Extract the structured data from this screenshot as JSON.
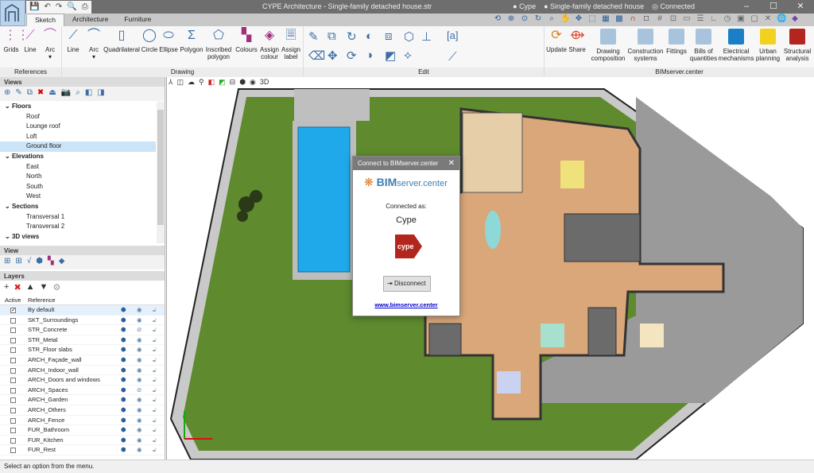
{
  "app": {
    "title": "CYPE Architecture - Single-family detached house.str",
    "user": "Cype",
    "project": "Single-family detached house",
    "connection": "Connected"
  },
  "tabs": [
    "Sketch",
    "Architecture",
    "Furniture"
  ],
  "ribbon": {
    "references": {
      "label": "References",
      "buttons": [
        "Grids",
        "Line",
        "Arc"
      ]
    },
    "drawing": {
      "label": "Drawing",
      "buttons": [
        "Line",
        "Arc",
        "Quadrilateral",
        "Circle",
        "Ellipse",
        "Polygon",
        "Inscribed polygon",
        "Colours",
        "Assign colour",
        "Assign label"
      ]
    },
    "edit": {
      "label": "Edit"
    },
    "bimserver": {
      "label": "BIMserver.center",
      "buttons": [
        "Update",
        "Share",
        "Drawing composition",
        "Construction systems",
        "Fittings",
        "Bills of quantities",
        "Electrical mechanisms",
        "Urban planning",
        "Structural analysis"
      ]
    }
  },
  "views": {
    "header": "Views",
    "groups": [
      {
        "label": "Floors",
        "items": [
          "Roof",
          "Lounge roof",
          "Loft",
          "Ground floor"
        ]
      },
      {
        "label": "Elevations",
        "items": [
          "East",
          "North",
          "South",
          "West"
        ]
      },
      {
        "label": "Sections",
        "items": [
          "Transversal 1",
          "Transversal 2"
        ]
      },
      {
        "label": "3D views",
        "items": []
      }
    ],
    "selected": "Ground floor"
  },
  "view_panel": {
    "header": "View"
  },
  "layers": {
    "header": "Layers",
    "columns": [
      "Active",
      "Reference"
    ],
    "rows": [
      {
        "name": "By default",
        "active": true,
        "visible": true
      },
      {
        "name": "SKT_Surroundings",
        "active": false,
        "visible": true
      },
      {
        "name": "STR_Concrete",
        "active": false,
        "visible": false
      },
      {
        "name": "STR_Metal",
        "active": false,
        "visible": true
      },
      {
        "name": "STR_Floor slabs",
        "active": false,
        "visible": true
      },
      {
        "name": "ARCH_Façade_wall",
        "active": false,
        "visible": true
      },
      {
        "name": "ARCH_Indoor_wall",
        "active": false,
        "visible": true
      },
      {
        "name": "ARCH_Doors and windows",
        "active": false,
        "visible": true
      },
      {
        "name": "ARCH_Spaces",
        "active": false,
        "visible": false
      },
      {
        "name": "ARCH_Garden",
        "active": false,
        "visible": true
      },
      {
        "name": "ARCH_Others",
        "active": false,
        "visible": true
      },
      {
        "name": "ARCH_Fence",
        "active": false,
        "visible": true
      },
      {
        "name": "FUR_Bathroom",
        "active": false,
        "visible": true
      },
      {
        "name": "FUR_Kitchen",
        "active": false,
        "visible": true
      },
      {
        "name": "FUR_Rest",
        "active": false,
        "visible": true
      }
    ]
  },
  "dialog": {
    "title": "Connect to BIMserver.center",
    "logo_bold": "BIM",
    "logo_rest": "server.center",
    "connected_as": "Connected as:",
    "user": "Cype",
    "logo_text": "cype",
    "disconnect": "Disconnect",
    "link": "www.bimserver.center"
  },
  "status": "Select an option from the menu.",
  "colors": {
    "accent": "#3a6ea5",
    "grass": "#5f8a2e",
    "pool": "#1fa9ea",
    "floor": "#d9a77a",
    "cype_red": "#b3261e"
  }
}
